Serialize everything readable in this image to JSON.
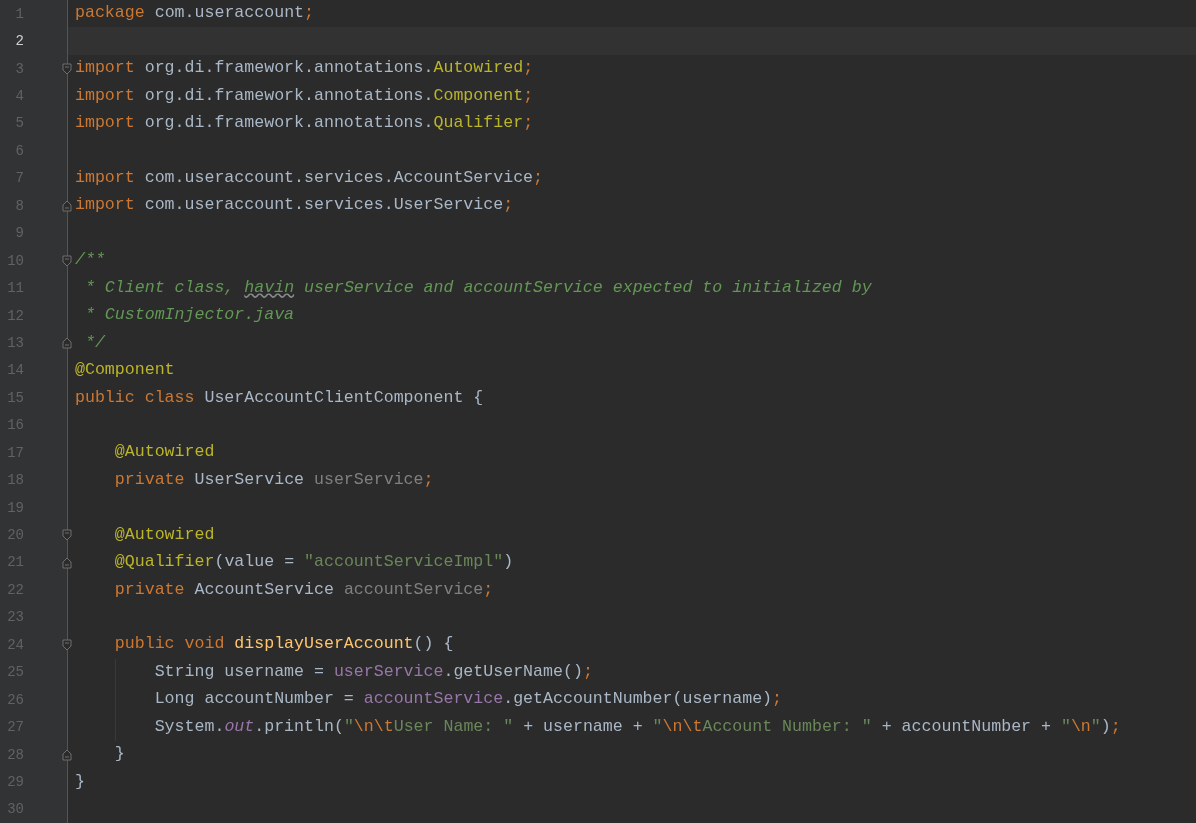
{
  "editor": {
    "lines": [
      {
        "number": "1",
        "current": false,
        "tokens": [
          {
            "text": "package",
            "kind": "keyword"
          },
          {
            "text": " com.useraccount",
            "kind": "plain"
          },
          {
            "text": ";",
            "kind": "keyword"
          }
        ]
      },
      {
        "number": "2",
        "current": true
      },
      {
        "number": "3",
        "current": false,
        "fold_start": true,
        "tokens": [
          {
            "text": "import",
            "kind": "keyword"
          },
          {
            "text": " org.di.framework.annotations.",
            "kind": "plain"
          },
          {
            "text": "Autowired",
            "kind": "annotation"
          },
          {
            "text": ";",
            "kind": "keyword"
          }
        ]
      },
      {
        "number": "4",
        "current": false,
        "tokens": [
          {
            "text": "import",
            "kind": "keyword"
          },
          {
            "text": " org.di.framework.annotations.",
            "kind": "plain"
          },
          {
            "text": "Component",
            "kind": "annotation"
          },
          {
            "text": ";",
            "kind": "keyword"
          }
        ]
      },
      {
        "number": "5",
        "current": false,
        "tokens": [
          {
            "text": "import",
            "kind": "keyword"
          },
          {
            "text": " org.di.framework.annotations.",
            "kind": "plain"
          },
          {
            "text": "Qualifier",
            "kind": "annotation"
          },
          {
            "text": ";",
            "kind": "keyword"
          }
        ]
      },
      {
        "number": "6",
        "current": false
      },
      {
        "number": "7",
        "current": false,
        "tokens": [
          {
            "text": "import",
            "kind": "keyword"
          },
          {
            "text": " com.useraccount.services.AccountService",
            "kind": "plain"
          },
          {
            "text": ";",
            "kind": "keyword"
          }
        ]
      },
      {
        "number": "8",
        "current": false,
        "fold_end": true,
        "tokens": [
          {
            "text": "import",
            "kind": "keyword"
          },
          {
            "text": " com.useraccount.services.UserService",
            "kind": "plain"
          },
          {
            "text": ";",
            "kind": "keyword"
          }
        ]
      },
      {
        "number": "9",
        "current": false
      },
      {
        "number": "10",
        "current": false,
        "fold_start": true,
        "tokens": [
          {
            "text": "/**",
            "kind": "comment"
          }
        ]
      },
      {
        "number": "11",
        "current": false,
        "tokens": [
          {
            "text": " * Client class, ",
            "kind": "comment"
          },
          {
            "text": "havin",
            "kind": "typo"
          },
          {
            "text": " userService and accountService expected to initialized by",
            "kind": "comment"
          }
        ]
      },
      {
        "number": "12",
        "current": false,
        "tokens": [
          {
            "text": " * CustomInjector.java",
            "kind": "comment"
          }
        ]
      },
      {
        "number": "13",
        "current": false,
        "fold_end": true,
        "tokens": [
          {
            "text": " */",
            "kind": "comment"
          }
        ]
      },
      {
        "number": "14",
        "current": false,
        "tokens": [
          {
            "text": "@Component",
            "kind": "annotation"
          }
        ]
      },
      {
        "number": "15",
        "current": false,
        "tokens": [
          {
            "text": "public class",
            "kind": "keyword"
          },
          {
            "text": " UserAccountClientComponent {",
            "kind": "plain"
          }
        ]
      },
      {
        "number": "16",
        "current": false
      },
      {
        "number": "17",
        "current": false,
        "tokens": [
          {
            "text": "    @Autowired",
            "kind": "annotation"
          }
        ]
      },
      {
        "number": "18",
        "current": false,
        "tokens": [
          {
            "text": "    private",
            "kind": "keyword"
          },
          {
            "text": " UserService ",
            "kind": "plain"
          },
          {
            "text": "userService",
            "kind": "unused"
          },
          {
            "text": ";",
            "kind": "keyword"
          }
        ]
      },
      {
        "number": "19",
        "current": false
      },
      {
        "number": "20",
        "current": false,
        "fold_start": true,
        "tokens": [
          {
            "text": "    @Autowired",
            "kind": "annotation"
          }
        ]
      },
      {
        "number": "21",
        "current": false,
        "fold_end": true,
        "tokens": [
          {
            "text": "    @Qualifier",
            "kind": "annotation"
          },
          {
            "text": "(value = ",
            "kind": "plain"
          },
          {
            "text": "\"accountServiceImpl\"",
            "kind": "string"
          },
          {
            "text": ")",
            "kind": "plain"
          }
        ]
      },
      {
        "number": "22",
        "current": false,
        "tokens": [
          {
            "text": "    private",
            "kind": "keyword"
          },
          {
            "text": " AccountService ",
            "kind": "plain"
          },
          {
            "text": "accountService",
            "kind": "unused"
          },
          {
            "text": ";",
            "kind": "keyword"
          }
        ]
      },
      {
        "number": "23",
        "current": false
      },
      {
        "number": "24",
        "current": false,
        "fold_start": true,
        "tokens": [
          {
            "text": "    public void",
            "kind": "keyword"
          },
          {
            "text": " displayUserAccount",
            "kind": "method"
          },
          {
            "text": "() {",
            "kind": "plain"
          }
        ]
      },
      {
        "number": "25",
        "current": false,
        "indent_guide": true,
        "tokens": [
          {
            "text": "        String username = ",
            "kind": "plain"
          },
          {
            "text": "userService",
            "kind": "field"
          },
          {
            "text": ".getUserName()",
            "kind": "plain"
          },
          {
            "text": ";",
            "kind": "keyword"
          }
        ]
      },
      {
        "number": "26",
        "current": false,
        "indent_guide": true,
        "tokens": [
          {
            "text": "        Long accountNumber = ",
            "kind": "plain"
          },
          {
            "text": "accountService",
            "kind": "field"
          },
          {
            "text": ".getAccountNumber(username)",
            "kind": "plain"
          },
          {
            "text": ";",
            "kind": "keyword"
          }
        ]
      },
      {
        "number": "27",
        "current": false,
        "indent_guide": true,
        "tokens": [
          {
            "text": "        System.",
            "kind": "plain"
          },
          {
            "text": "out",
            "kind": "static"
          },
          {
            "text": ".println(",
            "kind": "plain"
          },
          {
            "text": "\"",
            "kind": "string"
          },
          {
            "text": "\\n\\t",
            "kind": "escape"
          },
          {
            "text": "User Name: \"",
            "kind": "string"
          },
          {
            "text": " + username + ",
            "kind": "plain"
          },
          {
            "text": "\"",
            "kind": "string"
          },
          {
            "text": "\\n\\t",
            "kind": "escape"
          },
          {
            "text": "Account Number: \"",
            "kind": "string"
          },
          {
            "text": " + accountNumber + ",
            "kind": "plain"
          },
          {
            "text": "\"",
            "kind": "string"
          },
          {
            "text": "\\n",
            "kind": "escape"
          },
          {
            "text": "\"",
            "kind": "string"
          },
          {
            "text": ")",
            "kind": "plain"
          },
          {
            "text": ";",
            "kind": "keyword"
          }
        ]
      },
      {
        "number": "28",
        "current": false,
        "fold_end": true,
        "tokens": [
          {
            "text": "    }",
            "kind": "plain"
          }
        ]
      },
      {
        "number": "29",
        "current": false,
        "tokens": [
          {
            "text": "}",
            "kind": "plain"
          }
        ]
      },
      {
        "number": "30",
        "current": false
      }
    ]
  }
}
